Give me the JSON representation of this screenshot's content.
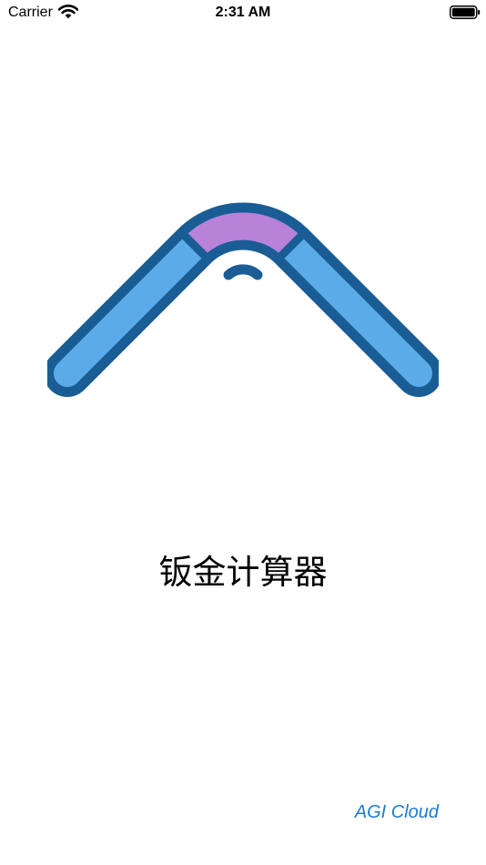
{
  "status_bar": {
    "carrier": "Carrier",
    "time": "2:31 AM",
    "wifi_icon": "wifi-icon",
    "battery_icon": "battery-full-icon"
  },
  "splash": {
    "logo_icon": "bent-sheet-metal-logo-icon",
    "app_title": "钣金计算器",
    "brand": "AGI Cloud"
  },
  "colors": {
    "logo_outline": "#1a5d95",
    "logo_fill": "#5aabe8",
    "logo_bend": "#b882d9",
    "brand_text": "#1a7ad4",
    "background": "#ffffff"
  }
}
